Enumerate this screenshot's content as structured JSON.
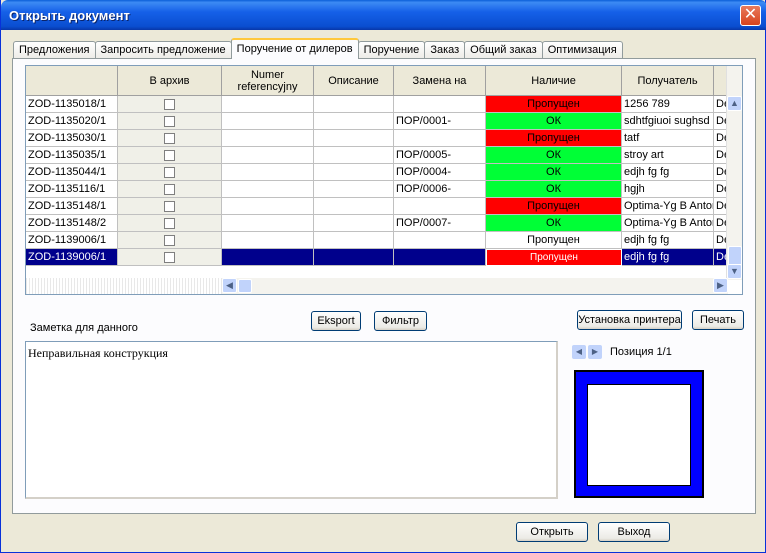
{
  "window": {
    "title": "Открыть документ",
    "close": "✕"
  },
  "tabs": [
    {
      "label": "Предложения"
    },
    {
      "label": "Запросить предложение"
    },
    {
      "label": "Поручение от дилеров"
    },
    {
      "label": "Поручение"
    },
    {
      "label": "Заказ"
    },
    {
      "label": "Общий заказ"
    },
    {
      "label": "Оптимизация"
    }
  ],
  "grid": {
    "headers": {
      "id": "",
      "archive": "В архив",
      "numer": "Numer referencyjny",
      "desc": "Описание",
      "replace": "Замена на",
      "avail": "Наличие",
      "recipient": "Получатель",
      "extra": ""
    },
    "rows": [
      {
        "id": "ZOD-1135018/1",
        "numer": "",
        "desc": "",
        "replace": "",
        "avail": "Пропущен",
        "status": "red",
        "recipient": "1256  789",
        "extra": "De"
      },
      {
        "id": "ZOD-1135020/1",
        "numer": "",
        "desc": "",
        "replace": "ПОР/0001-",
        "avail": "ОК",
        "status": "green",
        "recipient": "sdhtfgiuoi sughsd",
        "extra": "De"
      },
      {
        "id": "ZOD-1135030/1",
        "numer": "",
        "desc": "",
        "replace": "",
        "avail": "Пропущен",
        "status": "red",
        "recipient": "tatf",
        "extra": "De"
      },
      {
        "id": "ZOD-1135035/1",
        "numer": "",
        "desc": "",
        "replace": "ПОР/0005-",
        "avail": "ОК",
        "status": "green",
        "recipient": "stroy art",
        "extra": "De"
      },
      {
        "id": "ZOD-1135044/1",
        "numer": "",
        "desc": "",
        "replace": "ПОР/0004-",
        "avail": "ОК",
        "status": "green",
        "recipient": "edjh fg fg",
        "extra": "De"
      },
      {
        "id": "ZOD-1135116/1",
        "numer": "",
        "desc": "",
        "replace": "ПОР/0006-",
        "avail": "ОК",
        "status": "green",
        "recipient": "hgjh",
        "extra": "De"
      },
      {
        "id": "ZOD-1135148/1",
        "numer": "",
        "desc": "",
        "replace": "",
        "avail": "Пропущен",
        "status": "red",
        "recipient": "Optima-Yg B Anton",
        "extra": "De"
      },
      {
        "id": "ZOD-1135148/2",
        "numer": "",
        "desc": "",
        "replace": "ПОР/0007-",
        "avail": "ОК",
        "status": "green",
        "recipient": "Optima-Yg B Anton",
        "extra": "De"
      },
      {
        "id": "ZOD-1139006/1",
        "numer": "",
        "desc": "",
        "replace": "",
        "avail": "Пропущен",
        "status": "plain",
        "recipient": "edjh fg fg",
        "extra": "De"
      },
      {
        "id": "ZOD-1139006/1",
        "numer": "",
        "desc": "",
        "replace": "",
        "avail": "Пропущен",
        "status": "red",
        "recipient": "edjh fg fg",
        "extra": "De",
        "selected": true
      }
    ]
  },
  "toolbar": {
    "export": "Eksport",
    "filter": "Фильтр",
    "printer_setup": "Установка принтера",
    "print": "Печать"
  },
  "note": {
    "label": "Заметка для данного",
    "text": "Неправильная конструкция"
  },
  "position": {
    "label": "Позиция 1/1",
    "prev": "◀",
    "next": "▶"
  },
  "footer": {
    "open": "Открыть",
    "exit": "Выход"
  },
  "colors": {
    "red": "#ff0000",
    "green": "#00ff36",
    "selected": "#00008c",
    "preview_border": "#0000ff"
  }
}
